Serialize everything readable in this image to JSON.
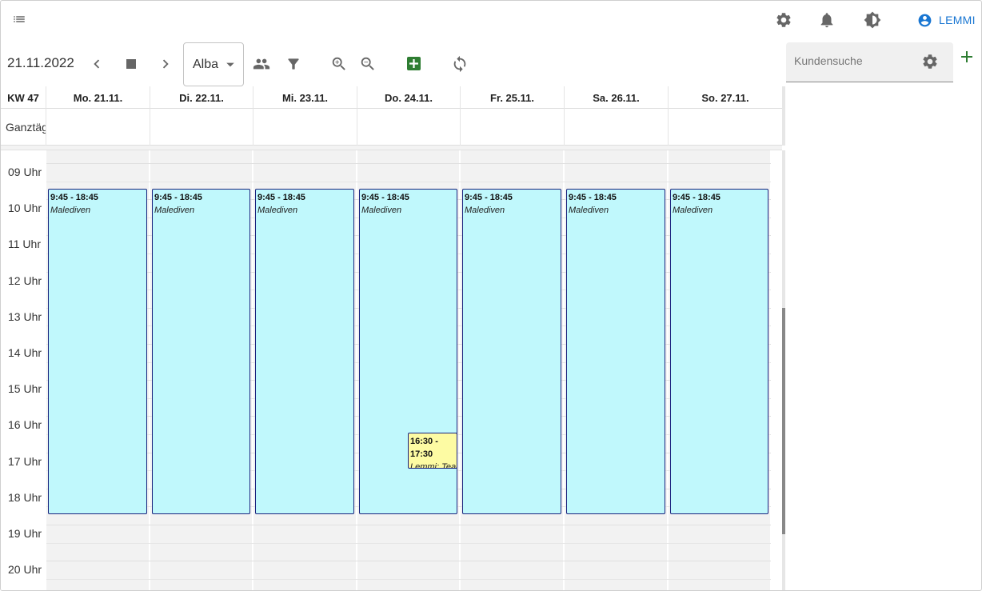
{
  "topbar": {
    "user_name": "LEMMI"
  },
  "toolbar": {
    "date": "21.11.2022",
    "staff_select": "Alba"
  },
  "search": {
    "placeholder": "Kundensuche"
  },
  "calendar": {
    "week_label": "KW 47",
    "allday_label": "Ganztägig",
    "days": [
      "Mo. 21.11.",
      "Di. 22.11.",
      "Mi. 23.11.",
      "Do. 24.11.",
      "Fr. 25.11.",
      "Sa. 26.11.",
      "So. 27.11."
    ],
    "hours": [
      "09 Uhr",
      "10 Uhr",
      "11 Uhr",
      "12 Uhr",
      "13 Uhr",
      "14 Uhr",
      "15 Uhr",
      "16 Uhr",
      "17 Uhr",
      "18 Uhr",
      "19 Uhr",
      "20 Uhr"
    ],
    "events": [
      {
        "day": 0,
        "time": "9:45 - 18:45",
        "title": "Malediven"
      },
      {
        "day": 1,
        "time": "9:45 - 18:45",
        "title": "Malediven"
      },
      {
        "day": 2,
        "time": "9:45 - 18:45",
        "title": "Malediven"
      },
      {
        "day": 3,
        "time": "9:45 - 18:45",
        "title": "Malediven"
      },
      {
        "day": 4,
        "time": "9:45 - 18:45",
        "title": "Malediven"
      },
      {
        "day": 5,
        "time": "9:45 - 18:45",
        "title": "Malediven"
      },
      {
        "day": 6,
        "time": "9:45 - 18:45",
        "title": "Malediven"
      }
    ],
    "small_event": {
      "day": 3,
      "time": "16:30 - 17:30",
      "title": "Lemmi: Team"
    }
  },
  "colors": {
    "event_bg": "#c0f8fc",
    "event_border": "#1a237e",
    "small_event_bg": "#fdfba3",
    "accent": "#1976d2",
    "add_green": "#2e7d32"
  }
}
